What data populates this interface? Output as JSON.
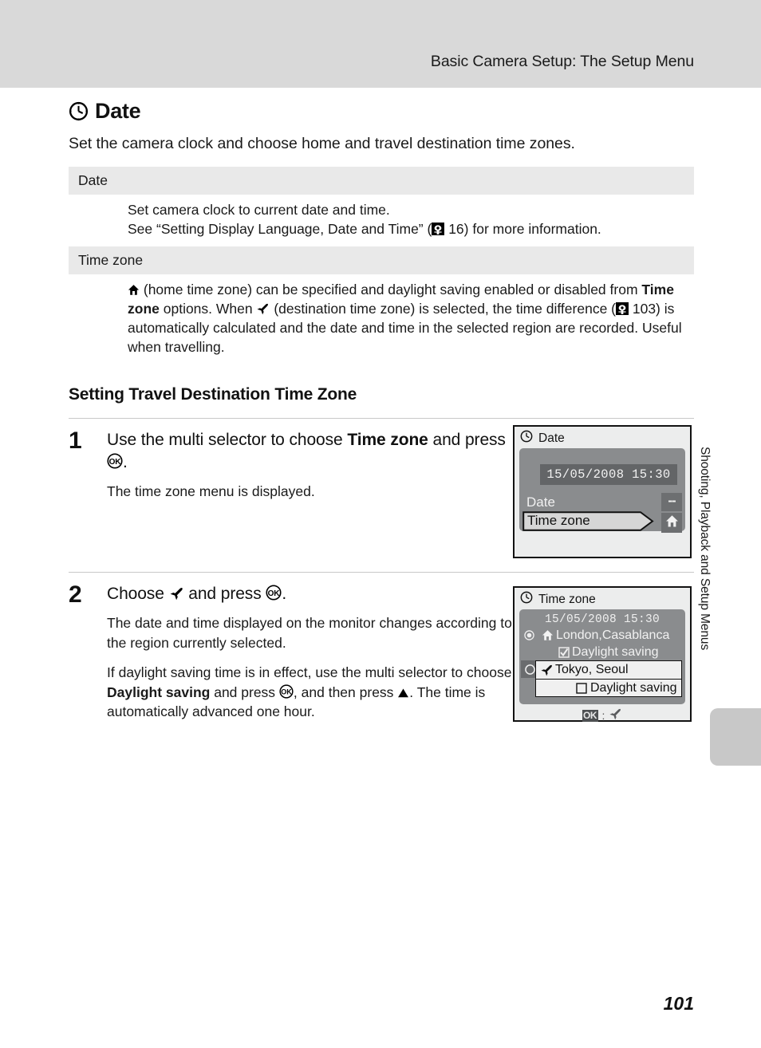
{
  "header": {
    "running_title": "Basic Camera Setup: The Setup Menu"
  },
  "section": {
    "icon": "clock-icon",
    "title": "Date",
    "intro": "Set the camera clock and choose home and travel destination time zones."
  },
  "spec_table": {
    "rows": [
      {
        "header": "Date",
        "lines": [
          "Set camera clock to current date and time.",
          "See “Setting Display Language, Date and Time” (",
          " 16) for more information."
        ]
      },
      {
        "header": "Time zone",
        "body_part1": " (home time zone) can be specified and daylight saving enabled or disabled from ",
        "body_bold": "Time zone",
        "body_part2": " options. When ",
        "body_part3": " (destination time zone) is selected, the time difference (",
        "body_part4": " 103) is automatically calculated and the date and time in the selected region are recorded. Useful when travelling."
      }
    ]
  },
  "sub_heading": "Setting Travel Destination Time Zone",
  "steps": [
    {
      "number": "1",
      "lead_part1": "Use the multi selector to choose ",
      "lead_bold": "Time zone",
      "lead_part2": " and press ",
      "lead_part3": ".",
      "note": "The time zone menu is displayed."
    },
    {
      "number": "2",
      "lead_part1": "Choose ",
      "lead_part2": " and press ",
      "lead_part3": ".",
      "note1": "The date and time displayed on the monitor changes according to the region currently selected.",
      "note2_part1": "If daylight saving time is in effect, use the multi selector to choose ",
      "note2_bold": "Daylight saving",
      "note2_part2": " and press ",
      "note2_part3": ", and then press ",
      "note2_part4": ". The time is automatically advanced one hour."
    }
  ],
  "lcd_screen_1": {
    "title_icon": "clock-icon",
    "title": "Date",
    "datetime": "15/05/2008  15:30",
    "menu_items": [
      {
        "label": "Date",
        "right_indicator": "--",
        "selected": false
      },
      {
        "label": "Time zone",
        "right_indicator": "home-icon",
        "selected": true
      }
    ]
  },
  "lcd_screen_2": {
    "title_icon": "clock-icon",
    "title": "Time zone",
    "datetime": "15/05/2008   15:30",
    "rows": [
      {
        "radio": "selected",
        "icon": "home-icon",
        "label": "London,Casablanca",
        "highlight": false
      },
      {
        "checkbox": "checked",
        "label": "Daylight saving",
        "highlight": false
      },
      {
        "radio": "unselected",
        "icon": "plane-icon",
        "label": "Tokyo, Seoul",
        "highlight": true
      },
      {
        "checkbox": "unchecked",
        "label": "Daylight saving",
        "highlight": true
      }
    ],
    "footer": {
      "button": "OK",
      "separator": ":",
      "icon": "plane-icon"
    }
  },
  "side_tab": {
    "label": "Shooting, Playback and Setup Menus"
  },
  "footer": {
    "page_number": "101"
  },
  "colors": {
    "header_band": "#d9d9d9",
    "table_header": "#e9e9e9",
    "lcd_panel": "#8a8c8e",
    "lcd_border": "#121212",
    "side_tab_marker": "#c8c8c8"
  }
}
